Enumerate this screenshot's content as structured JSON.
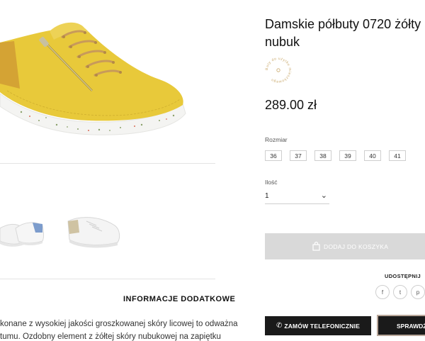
{
  "product": {
    "title_line1": "Damskie półbuty 0720 żółty",
    "title_line2": "nubuk",
    "badge_text": "Buty do użytku mieszkowego",
    "price": "289.00 zł"
  },
  "size_selector": {
    "label": "Rozmiar",
    "options": [
      "36",
      "37",
      "38",
      "39",
      "40",
      "41"
    ]
  },
  "quantity": {
    "label": "Ilość",
    "value": "1"
  },
  "actions": {
    "add_to_cart": "DODAJ DO KOSZYKA",
    "phone_order": "ZAMÓW TELEFONICZNIE",
    "check": "SPRAWDŹ"
  },
  "share": {
    "label": "UDOSTĘPNIJ",
    "networks": [
      "f",
      "t",
      "p"
    ]
  },
  "info": {
    "heading": "INFORMACJE DODATKOWE",
    "desc_line1": "konane z wysokiej jakości groszkowanej skóry licowej to odważna",
    "desc_line2": "tumu. Ozdobny element z żółtej skóry nubukowej na zapiętku"
  },
  "icons": {
    "cart": "shopping-bag-icon",
    "phone": "phone-icon",
    "chevron": "chevron-down-icon"
  },
  "colors": {
    "accent_dark": "#1a1a1a",
    "cart_disabled": "#d9d9d9",
    "shoe_yellow": "#e8c93a",
    "badge_gold": "#c9a86a"
  }
}
